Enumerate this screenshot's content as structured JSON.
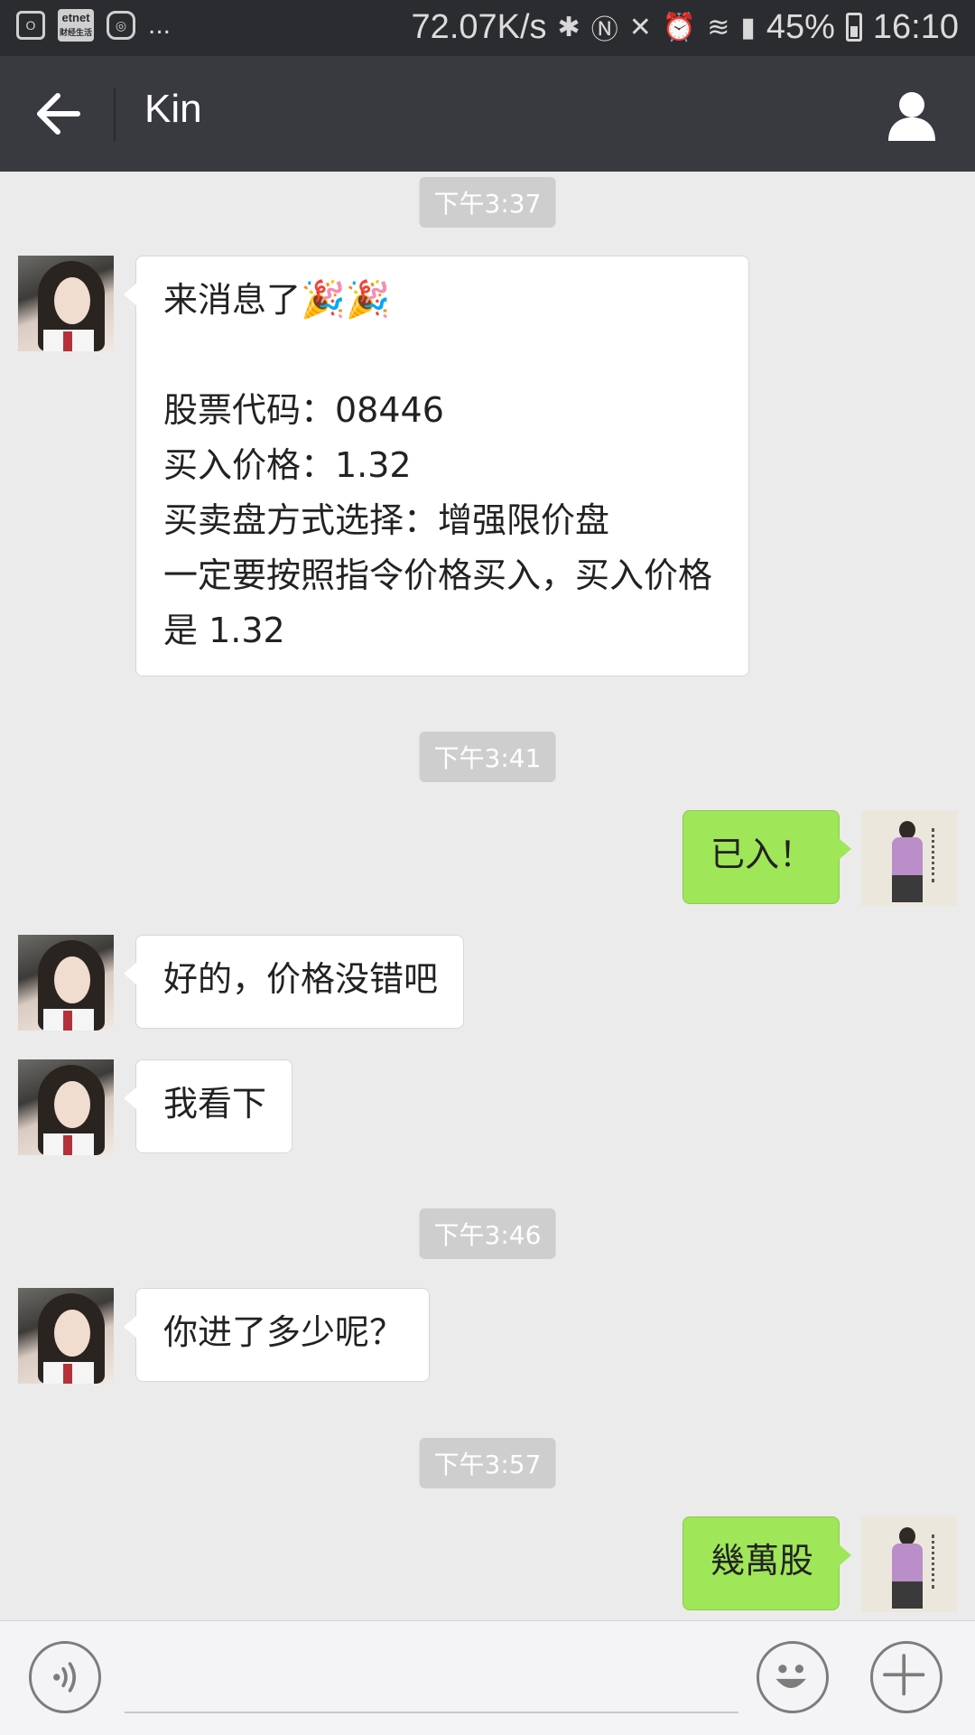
{
  "status_bar": {
    "left_icons": [
      "outlook-icon",
      "etnet-icon",
      "instagram-icon"
    ],
    "overflow": "...",
    "etnet_label": "etnet",
    "etnet_sub": "财经生活",
    "network_speed": "72.07K/s",
    "battery_percent": "45%",
    "battery_level": 0.45,
    "time": "16:10"
  },
  "header": {
    "title": "Kin"
  },
  "messages": [
    {
      "type": "timestamp",
      "text": "下午3:37"
    },
    {
      "type": "incoming",
      "lines": [
        "来消息了",
        "",
        "股票代码：08446",
        "买入价格：1.32",
        "买卖盘方式选择：增强限价盘",
        "一定要按照指令价格买入，买入价格",
        "是 1.32"
      ],
      "emoji": "🎉🎉"
    },
    {
      "type": "timestamp",
      "text": "下午3:41"
    },
    {
      "type": "outgoing",
      "text": "已入！"
    },
    {
      "type": "incoming",
      "text": "好的，价格没错吧"
    },
    {
      "type": "incoming",
      "text": "我看下"
    },
    {
      "type": "timestamp",
      "text": "下午3:46"
    },
    {
      "type": "incoming",
      "text": "你进了多少呢？"
    },
    {
      "type": "timestamp",
      "text": "下午3:57"
    },
    {
      "type": "outgoing",
      "text": "幾萬股"
    }
  ],
  "colors": {
    "titlebar": "#393a3f",
    "background": "#ebebeb",
    "outgoing_bubble": "#9fe658",
    "incoming_bubble": "#ffffff"
  }
}
